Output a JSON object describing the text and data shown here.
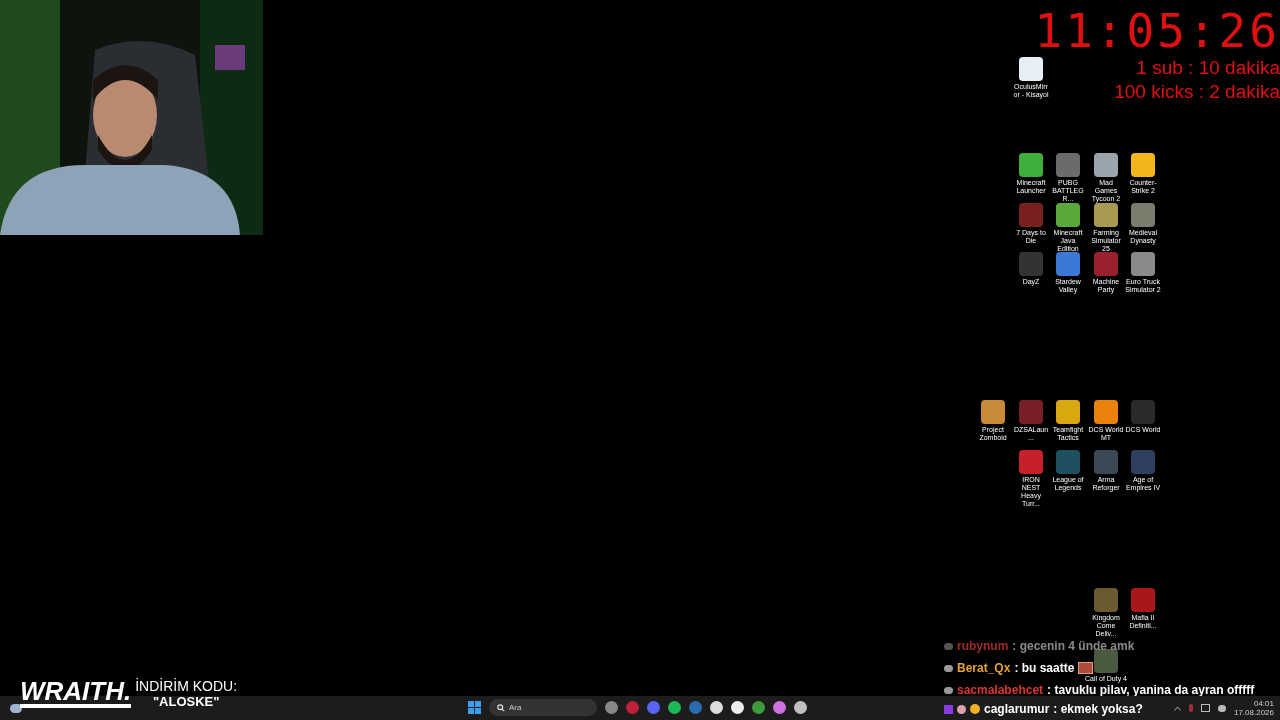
{
  "timer": {
    "time": "11:05:26",
    "rules": [
      "1 sub : 10 dakika",
      "100 kicks : 2 dakika"
    ]
  },
  "desktop_icons": [
    {
      "label": "OculusMirror - Kisayol"
    },
    {
      "label": "Minecraft Launcher"
    },
    {
      "label": "PUBG BATTLEGR..."
    },
    {
      "label": "Mad Games Tycoon 2"
    },
    {
      "label": "Counter-Strike 2"
    },
    {
      "label": "7 Days to Die"
    },
    {
      "label": "Minecraft Java Edition"
    },
    {
      "label": "Farming Simulator 25"
    },
    {
      "label": "Medieval Dynasty"
    },
    {
      "label": "DayZ"
    },
    {
      "label": "Stardew Valley"
    },
    {
      "label": "Machine Party"
    },
    {
      "label": "Euro Truck Simulator 2"
    },
    {
      "label": "Project Zomboid"
    },
    {
      "label": "DZSALaun..."
    },
    {
      "label": "Teamfight Tactics"
    },
    {
      "label": "DCS World MT"
    },
    {
      "label": "DCS World"
    },
    {
      "label": "IRON NEST Heavy Turr..."
    },
    {
      "label": "League of Legends"
    },
    {
      "label": "Arma Reforger"
    },
    {
      "label": "Age of Empires IV"
    },
    {
      "label": "Kingdom Come Deliv..."
    },
    {
      "label": "Mafia II Definiti..."
    },
    {
      "label": "Call of Duty 4"
    }
  ],
  "chat": [
    {
      "user": "rubynum",
      "color": "#a02a2a",
      "message": ": gecenin 4 ünde amk",
      "dimmed": true
    },
    {
      "user": "Berat_Qx",
      "color": "#e8a23a",
      "message": ": bu saatte",
      "dimmed": false,
      "emote": true
    },
    {
      "user": "sacmalabehcet",
      "color": "#d9382e",
      "message": ": tavuklu pilav, yanina da ayran offfff",
      "dimmed": false
    },
    {
      "user": "caglarumur",
      "color": "#ffffff",
      "message": ": ekmek yoksa?",
      "dimmed": false
    }
  ],
  "sponsor": {
    "logo": "WRAITH.",
    "caption": "İNDİRİM KODU:",
    "code": "\"ALOSKE\""
  },
  "taskbar": {
    "search_placeholder": "Ara",
    "time": "04:01",
    "date": "17.08.2026"
  }
}
